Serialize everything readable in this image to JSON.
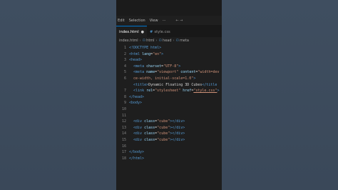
{
  "menu": {
    "items": [
      "Edit",
      "Selection",
      "View",
      "···"
    ],
    "nav": "← →"
  },
  "tabs": [
    {
      "label": "index.html",
      "modified_dot": "●"
    },
    {
      "label": "style.css",
      "icon": "#"
    }
  ],
  "breadcrumb": {
    "file": "index.html",
    "parts": [
      "html",
      "head",
      "meta"
    ]
  },
  "code": {
    "line_numbers": [
      "1",
      "2",
      "3",
      "4",
      "5",
      "6",
      "",
      "7",
      "8",
      "9",
      "10",
      "11",
      "12",
      "13",
      "14",
      "15",
      "16",
      "17",
      "18"
    ],
    "lines": [
      [
        {
          "c": "t-tag",
          "t": "<!DOCTYPE html>"
        }
      ],
      [
        {
          "c": "t-tag",
          "t": "<html "
        },
        {
          "c": "t-attr",
          "t": "lang"
        },
        {
          "c": "t-text",
          "t": "="
        },
        {
          "c": "t-str",
          "t": "\"en\""
        },
        {
          "c": "t-tag",
          "t": ">"
        }
      ],
      [
        {
          "c": "t-tag",
          "t": "<head>"
        }
      ],
      [
        {
          "c": "t-text",
          "t": "  "
        },
        {
          "c": "t-tag",
          "t": "<meta "
        },
        {
          "c": "t-attr",
          "t": "charset"
        },
        {
          "c": "t-text",
          "t": "="
        },
        {
          "c": "t-str",
          "t": "\"UTF-8\""
        },
        {
          "c": "t-tag",
          "t": ">"
        }
      ],
      [
        {
          "c": "t-text",
          "t": "  "
        },
        {
          "c": "t-tag",
          "t": "<meta "
        },
        {
          "c": "t-attr",
          "t": "name"
        },
        {
          "c": "t-text",
          "t": "="
        },
        {
          "c": "t-str",
          "t": "\"viewport\""
        },
        {
          "c": "t-text",
          "t": " "
        },
        {
          "c": "t-attr",
          "t": "content"
        },
        {
          "c": "t-text",
          "t": "="
        },
        {
          "c": "t-str",
          "t": "\"width=dev"
        }
      ],
      [
        {
          "c": "t-str",
          "t": "  ce-width, initial-scale=1.0\""
        },
        {
          "c": "t-tag",
          "t": ">"
        }
      ],
      [
        {
          "c": "t-text",
          "t": "  "
        },
        {
          "c": "t-tag",
          "t": "<title>"
        },
        {
          "c": "t-text",
          "t": "Dynamic Floating 3D Cubes"
        },
        {
          "c": "t-tag",
          "t": "</title"
        }
      ],
      [
        {
          "c": "t-text",
          "t": "  "
        },
        {
          "c": "t-tag",
          "t": "<link "
        },
        {
          "c": "t-attr",
          "t": "rel"
        },
        {
          "c": "t-text",
          "t": "="
        },
        {
          "c": "t-str",
          "t": "\"stylesheet\""
        },
        {
          "c": "t-text",
          "t": " "
        },
        {
          "c": "t-attr",
          "t": "href"
        },
        {
          "c": "t-text",
          "t": "="
        },
        {
          "c": "t-link",
          "t": "\"style.css\""
        },
        {
          "c": "t-tag",
          "t": ">"
        }
      ],
      [
        {
          "c": "t-tag",
          "t": "</head>"
        }
      ],
      [
        {
          "c": "t-tag",
          "t": "<body>"
        }
      ],
      [
        {
          "c": "t-text",
          "t": ""
        }
      ],
      [
        {
          "c": "t-text",
          "t": ""
        }
      ],
      [
        {
          "c": "t-text",
          "t": "  "
        },
        {
          "c": "t-tag",
          "t": "<div "
        },
        {
          "c": "t-attr",
          "t": "class"
        },
        {
          "c": "t-text",
          "t": "="
        },
        {
          "c": "t-str",
          "t": "\"cube\""
        },
        {
          "c": "t-tag",
          "t": "></div>"
        }
      ],
      [
        {
          "c": "t-text",
          "t": "  "
        },
        {
          "c": "t-tag",
          "t": "<div "
        },
        {
          "c": "t-attr",
          "t": "class"
        },
        {
          "c": "t-text",
          "t": "="
        },
        {
          "c": "t-str",
          "t": "\"cube\""
        },
        {
          "c": "t-tag",
          "t": "></div>"
        }
      ],
      [
        {
          "c": "t-text",
          "t": "  "
        },
        {
          "c": "t-tag",
          "t": "<div "
        },
        {
          "c": "t-attr",
          "t": "class"
        },
        {
          "c": "t-text",
          "t": "="
        },
        {
          "c": "t-str",
          "t": "\"cube\""
        },
        {
          "c": "t-tag",
          "t": "></div>"
        }
      ],
      [
        {
          "c": "t-text",
          "t": "  "
        },
        {
          "c": "t-tag",
          "t": "<div "
        },
        {
          "c": "t-attr",
          "t": "class"
        },
        {
          "c": "t-text",
          "t": "="
        },
        {
          "c": "t-str",
          "t": "\"cube\""
        },
        {
          "c": "t-tag",
          "t": "></div>"
        }
      ],
      [
        {
          "c": "t-text",
          "t": ""
        }
      ],
      [
        {
          "c": "t-tag",
          "t": "</body>"
        }
      ],
      [
        {
          "c": "t-tag",
          "t": "</html>"
        }
      ]
    ]
  }
}
